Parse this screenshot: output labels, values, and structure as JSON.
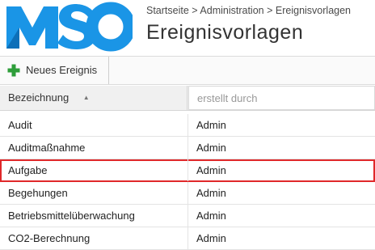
{
  "header": {
    "logo_text": "MSO",
    "breadcrumb": [
      "Startseite",
      "Administration",
      "Ereignisvorlagen"
    ],
    "separator": ">",
    "title": "Ereignisvorlagen"
  },
  "toolbar": {
    "new_label": "Neues Ereignis"
  },
  "table": {
    "columns": [
      "Bezeichnung",
      "erstellt durch"
    ],
    "sort_column": "Bezeichnung",
    "sort_direction": "ascending",
    "rows": [
      {
        "name": "Audit",
        "creator": "Admin"
      },
      {
        "name": "Auditmaßnahme",
        "creator": "Admin"
      },
      {
        "name": "Aufgabe",
        "creator": "Admin",
        "highlighted": true
      },
      {
        "name": "Begehungen",
        "creator": "Admin"
      },
      {
        "name": "Betriebsmittelüberwachung",
        "creator": "Admin"
      },
      {
        "name": "CO2-Berechnung",
        "creator": "Admin"
      }
    ]
  },
  "colors": {
    "logo_blue": "#1a95e6",
    "plus_green": "#2e9e3a",
    "highlight_red": "#e0282a"
  },
  "icons": {
    "new": "plus-icon",
    "sort": "sort-ascending-icon"
  }
}
